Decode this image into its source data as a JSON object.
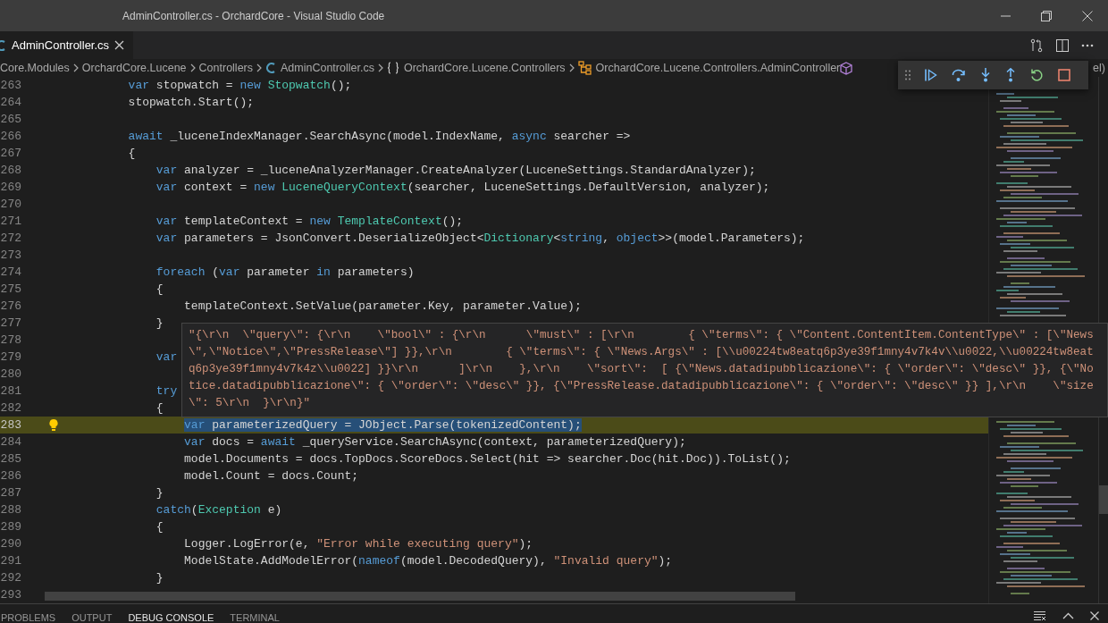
{
  "window": {
    "title": "AdminController.cs - OrchardCore - Visual Studio Code"
  },
  "tabs": [
    {
      "label": "AdminController.cs",
      "selected": true
    }
  ],
  "breadcrumb": [
    {
      "kind": "folder",
      "label": "Core.Modules"
    },
    {
      "kind": "folder",
      "label": "OrchardCore.Lucene"
    },
    {
      "kind": "folder",
      "label": "Controllers"
    },
    {
      "kind": "file",
      "label": "AdminController.cs"
    },
    {
      "kind": "namespace",
      "label": "OrchardCore.Lucene.Controllers"
    },
    {
      "kind": "class",
      "label": "OrchardCore.Lucene.Controllers.AdminController"
    },
    {
      "kind": "method",
      "label": "el)"
    }
  ],
  "editor": {
    "lines": [
      {
        "number": "263",
        "current": false,
        "selected": false,
        "tokens": [
          {
            "kind": "keyword",
            "text": "            var"
          },
          {
            "kind": "plain",
            "text": " stopwatch = "
          },
          {
            "kind": "keyword",
            "text": "new"
          },
          {
            "kind": "type",
            "text": " Stopwatch"
          },
          {
            "kind": "plain",
            "text": "();"
          }
        ]
      },
      {
        "number": "264",
        "current": false,
        "selected": false,
        "tokens": [
          {
            "kind": "plain",
            "text": "            stopwatch.Start();"
          }
        ]
      },
      {
        "number": "265",
        "current": false,
        "selected": false
      },
      {
        "number": "266",
        "current": false,
        "selected": false,
        "tokens": [
          {
            "kind": "keyword",
            "text": "            await"
          },
          {
            "kind": "plain",
            "text": " _luceneIndexManager.SearchAsync(model.IndexName, "
          },
          {
            "kind": "keyword",
            "text": "async"
          },
          {
            "kind": "plain",
            "text": " searcher =>"
          }
        ]
      },
      {
        "number": "267",
        "current": false,
        "selected": false,
        "tokens": [
          {
            "kind": "plain",
            "text": "            {"
          }
        ]
      },
      {
        "number": "268",
        "current": false,
        "selected": false,
        "tokens": [
          {
            "kind": "keyword",
            "text": "                var"
          },
          {
            "kind": "plain",
            "text": " analyzer = _luceneAnalyzerManager.CreateAnalyzer(LuceneSettings.StandardAnalyzer);"
          }
        ]
      },
      {
        "number": "269",
        "current": false,
        "selected": false,
        "tokens": [
          {
            "kind": "keyword",
            "text": "                var"
          },
          {
            "kind": "plain",
            "text": " context = "
          },
          {
            "kind": "keyword",
            "text": "new"
          },
          {
            "kind": "type",
            "text": " LuceneQueryContext"
          },
          {
            "kind": "plain",
            "text": "(searcher, LuceneSettings.DefaultVersion, analyzer);"
          }
        ]
      },
      {
        "number": "270",
        "current": false,
        "selected": false
      },
      {
        "number": "271",
        "current": false,
        "selected": false,
        "tokens": [
          {
            "kind": "keyword",
            "text": "                var"
          },
          {
            "kind": "plain",
            "text": " templateContext = "
          },
          {
            "kind": "keyword",
            "text": "new"
          },
          {
            "kind": "type",
            "text": " TemplateContext"
          },
          {
            "kind": "plain",
            "text": "();"
          }
        ]
      },
      {
        "number": "272",
        "current": false,
        "selected": false,
        "tokens": [
          {
            "kind": "keyword",
            "text": "                var"
          },
          {
            "kind": "plain",
            "text": " parameters = JsonConvert.DeserializeObject<"
          },
          {
            "kind": "type",
            "text": "Dictionary"
          },
          {
            "kind": "plain",
            "text": "<"
          },
          {
            "kind": "keyword",
            "text": "string"
          },
          {
            "kind": "plain",
            "text": ", "
          },
          {
            "kind": "keyword",
            "text": "object"
          },
          {
            "kind": "plain",
            "text": ">>(model.Parameters);"
          }
        ]
      },
      {
        "number": "273",
        "current": false,
        "selected": false
      },
      {
        "number": "274",
        "current": false,
        "selected": false,
        "tokens": [
          {
            "kind": "keyword",
            "text": "                foreach"
          },
          {
            "kind": "plain",
            "text": " ("
          },
          {
            "kind": "keyword",
            "text": "var"
          },
          {
            "kind": "plain",
            "text": " parameter "
          },
          {
            "kind": "keyword",
            "text": "in"
          },
          {
            "kind": "plain",
            "text": " parameters)"
          }
        ]
      },
      {
        "number": "275",
        "current": false,
        "selected": false,
        "tokens": [
          {
            "kind": "plain",
            "text": "                {"
          }
        ]
      },
      {
        "number": "276",
        "current": false,
        "selected": false,
        "tokens": [
          {
            "kind": "plain",
            "text": "                    templateContext.SetValue(parameter.Key, parameter.Value);"
          }
        ]
      },
      {
        "number": "277",
        "current": false,
        "selected": false,
        "tokens": [
          {
            "kind": "plain",
            "text": "                }"
          }
        ]
      },
      {
        "number": "278",
        "current": false,
        "selected": false
      },
      {
        "number": "279",
        "current": false,
        "selected": false,
        "tokens": [
          {
            "kind": "keyword",
            "text": "                var"
          }
        ]
      },
      {
        "number": "280",
        "current": false,
        "selected": false
      },
      {
        "number": "281",
        "current": false,
        "selected": false,
        "tokens": [
          {
            "kind": "keyword",
            "text": "                try"
          }
        ]
      },
      {
        "number": "282",
        "current": false,
        "selected": false,
        "tokens": [
          {
            "kind": "plain",
            "text": "                {"
          }
        ]
      },
      {
        "number": "283",
        "current": true,
        "selected": true,
        "lightbulb": true,
        "tokens": [
          {
            "kind": "keyword",
            "text": "                    var"
          },
          {
            "kind": "plain",
            "text": " parameterizedQuery = JObject.Parse(tokenizedContent);"
          }
        ]
      },
      {
        "number": "284",
        "current": false,
        "selected": false,
        "tokens": [
          {
            "kind": "keyword",
            "text": "                    var"
          },
          {
            "kind": "plain",
            "text": " docs = "
          },
          {
            "kind": "keyword",
            "text": "await"
          },
          {
            "kind": "plain",
            "text": " _queryService.SearchAsync(context, parameterizedQuery);"
          }
        ]
      },
      {
        "number": "285",
        "current": false,
        "selected": false,
        "tokens": [
          {
            "kind": "plain",
            "text": "                    model.Documents = docs.TopDocs.ScoreDocs.Select(hit => searcher.Doc(hit.Doc)).ToList();"
          }
        ]
      },
      {
        "number": "286",
        "current": false,
        "selected": false,
        "tokens": [
          {
            "kind": "plain",
            "text": "                    model.Count = docs.Count;"
          }
        ]
      },
      {
        "number": "287",
        "current": false,
        "selected": false,
        "tokens": [
          {
            "kind": "plain",
            "text": "                }"
          }
        ]
      },
      {
        "number": "288",
        "current": false,
        "selected": false,
        "tokens": [
          {
            "kind": "keyword",
            "text": "                catch"
          },
          {
            "kind": "plain",
            "text": "("
          },
          {
            "kind": "type",
            "text": "Exception"
          },
          {
            "kind": "plain",
            "text": " e)"
          }
        ]
      },
      {
        "number": "289",
        "current": false,
        "selected": false,
        "tokens": [
          {
            "kind": "plain",
            "text": "                {"
          }
        ]
      },
      {
        "number": "290",
        "current": false,
        "selected": false,
        "tokens": [
          {
            "kind": "plain",
            "text": "                    Logger.LogError(e, "
          },
          {
            "kind": "string",
            "text": "\"Error while executing query\""
          },
          {
            "kind": "plain",
            "text": ");"
          }
        ]
      },
      {
        "number": "291",
        "current": false,
        "selected": false,
        "tokens": [
          {
            "kind": "plain",
            "text": "                    ModelState.AddModelError("
          },
          {
            "kind": "keyword",
            "text": "nameof"
          },
          {
            "kind": "plain",
            "text": "(model.DecodedQuery), "
          },
          {
            "kind": "string",
            "text": "\"Invalid query\""
          },
          {
            "kind": "plain",
            "text": ");"
          }
        ]
      },
      {
        "number": "292",
        "current": false,
        "selected": false,
        "tokens": [
          {
            "kind": "plain",
            "text": "                }"
          }
        ]
      },
      {
        "number": "293",
        "current": false,
        "selected": false
      }
    ]
  },
  "hover": {
    "lines": [
      "\"{\\r\\n  \\\"query\\\": {\\r\\n    \\\"bool\\\" : {\\r\\n      \\\"must\\\" : [\\r\\n        { \\\"terms\\\": { \\\"Content.ContentItem.ContentType\\\" : [\\\"News",
      "\\\",\\\"Notice\\\",\\\"PressRelease\\\"] }},\\r\\n        { \\\"terms\\\": { \\\"News.Args\\\" : [\\\\u00224tw8eatq6p3ye39f1mny4v7k4v\\\\u0022,\\\\u00224tw8eat",
      "q6p3ye39f1mny4v7k4z\\\\u0022] }}\\r\\n      ]\\r\\n    },\\r\\n    \\\"sort\\\":  [ {\\\"News.datadipubblicazione\\\": { \\\"order\\\": \\\"desc\\\" }}, {\\\"No",
      "tice.datadipubblicazione\\\": { \\\"order\\\": \\\"desc\\\" }}, {\\\"PressRelease.datadipubblicazione\\\": { \\\"order\\\": \\\"desc\\\" }} ],\\r\\n    \\\"size",
      "\\\": 5\\r\\n  }\\r\\n}\""
    ]
  },
  "panel": {
    "tabs": [
      {
        "label": "PROBLEMS",
        "selected": false
      },
      {
        "label": "OUTPUT",
        "selected": false
      },
      {
        "label": "DEBUG CONSOLE",
        "selected": true
      },
      {
        "label": "TERMINAL",
        "selected": false
      }
    ]
  }
}
